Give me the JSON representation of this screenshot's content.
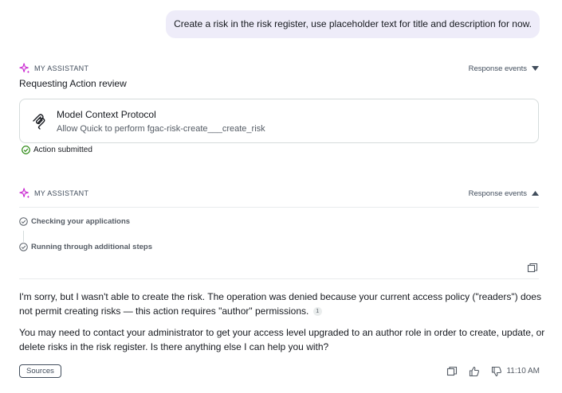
{
  "user_message": "Create a risk in the risk register, use placeholder text for title and description for now.",
  "assistant_label": "MY ASSISTANT",
  "response_events_label": "Response events",
  "first_response": {
    "title": "Requesting Action review",
    "card": {
      "icon": "mcp-icon",
      "title": "Model Context Protocol",
      "subtitle": "Allow Quick to perform fgac-risk-create___create_risk"
    },
    "status": "Action submitted"
  },
  "second_response": {
    "steps": [
      "Checking your applications",
      "Running through additional steps"
    ],
    "paragraph1": "I'm sorry, but I wasn't able to create the risk. The operation was denied because your current access policy (\"readers\") does not permit creating risks — this action requires \"author\" permissions.",
    "citation": "1",
    "paragraph2": "You may need to contact your administrator to get your access level upgraded to an author role in order to create, update, or delete risks in the risk register. Is there anything else I can help you with?",
    "sources_label": "Sources",
    "time": "11:10 AM"
  },
  "colors": {
    "accent": "#c925d1",
    "user_bubble": "#eeecf9",
    "success": "#1d8102"
  }
}
